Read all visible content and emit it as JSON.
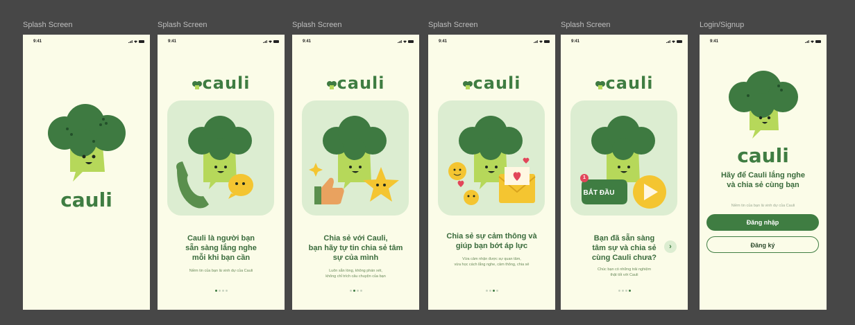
{
  "frames": [
    {
      "label": "Splash Screen"
    },
    {
      "label": "Splash Screen"
    },
    {
      "label": "Splash Screen"
    },
    {
      "label": "Splash Screen"
    },
    {
      "label": "Splash Screen"
    },
    {
      "label": "Login/Signup"
    }
  ],
  "status": {
    "time": "9:41"
  },
  "brand": {
    "logo": "cauli",
    "logo_large": "cauli"
  },
  "screens": [
    {},
    {
      "headline": [
        "Cauli là người bạn",
        "sẵn sàng lắng nghe",
        "mỗi khi bạn cần"
      ],
      "subtext": [
        "Niềm tin của bạn là vinh dự của Cauli"
      ],
      "active_dot": 0
    },
    {
      "headline": [
        "Chia sẻ với Cauli,",
        "bạn hãy tự tin chia sẻ tâm",
        "sự của mình"
      ],
      "subtext": [
        "Luôn sẵn lòng, không phán xét,",
        "không chỉ trích câu chuyện của bạn"
      ],
      "active_dot": 1
    },
    {
      "headline": [
        "Chia sẻ sự cảm thông và",
        "giúp bạn bớt áp lực"
      ],
      "subtext": [
        "Vừa cảm nhận được sự quan tâm,",
        "vừa học cách lắng nghe, cảm thông, chia sẻ"
      ],
      "active_dot": 2
    },
    {
      "headline": [
        "Bạn đã sẵn sàng",
        "tâm sự và chia sẻ",
        "cùng Cauli chưa?"
      ],
      "subtext": [
        "Chúc bạn có những trải nghiệm",
        "thật tốt với Cauli"
      ],
      "active_dot": 3,
      "start_button": "BẮT ĐẦU",
      "badge_count": "1"
    },
    {
      "headline": [
        "Hãy để Cauli lắng nghe",
        "và chia sẻ cùng bạn"
      ],
      "subtext": [
        "Niềm tin của bạn là vinh dự của Cauli"
      ],
      "login_button": "Đăng nhập",
      "signup_button": "Đăng ký"
    }
  ],
  "colors": {
    "background": "#474747",
    "screen": "#fbfce8",
    "brand_green": "#3f7d42",
    "broccoli_dark": "#3e7a41",
    "broccoli_body": "#b6d85a",
    "card": "#dcedd1",
    "accent_yellow": "#f4c531"
  },
  "icons": [
    "signal-icon",
    "wifi-icon",
    "battery-icon",
    "phone-icon",
    "chat-bubble-icon",
    "thumbs-up-icon",
    "star-icon",
    "sparkle-icon",
    "heart-icon",
    "envelope-icon",
    "emoji-icon",
    "play-icon",
    "chevron-right-icon"
  ]
}
